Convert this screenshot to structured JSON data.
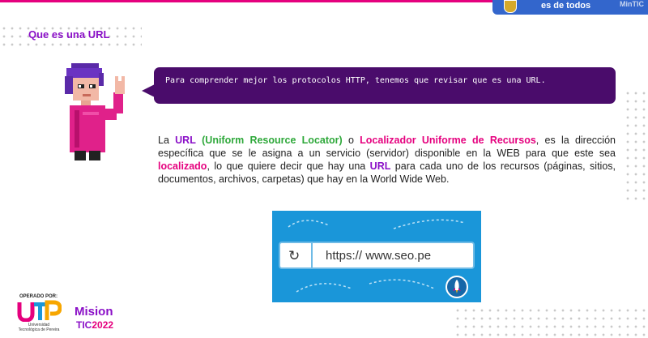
{
  "header": {
    "gov_tagline": "es de todos",
    "gov_entity": "MinTIC"
  },
  "page": {
    "title": "Que es una URL"
  },
  "speech": {
    "text": "Para comprender mejor los protocolos HTTP, tenemos que revisar que es una URL."
  },
  "body": {
    "p1": "La ",
    "url": "URL",
    "url_full": "(Uniform Resource Locator)",
    "o": " o ",
    "localizador": "Localizador Uniforme de Recursos",
    "p2": ", es la dirección específica que se le asigna a un servicio (servidor) disponible en la WEB para que este sea ",
    "localizado": "localizado",
    "p3": ", lo que quiere decir que hay una ",
    "url2": "URL",
    "p4": " para cada uno de los recursos (páginas, sitios, documentos, archivos, carpetas) que hay en la World Wide Web."
  },
  "illustration": {
    "url": "https:// www.seo.pe",
    "refresh_icon": "refresh-icon",
    "rocket_icon": "rocket-icon"
  },
  "footer": {
    "operated_by": "OPERADO POR:",
    "utp_name": "Universidad Tecnológica de Pereira",
    "mision": "Mision",
    "tic": "TIC",
    "year": "2022"
  },
  "colors": {
    "purple": "#8a0fc7",
    "pink": "#e5007e",
    "green": "#2ea83a",
    "speech_bg": "#4a0c6b",
    "gov_blue": "#3366cc",
    "illustration_bg": "#1a96d9"
  }
}
